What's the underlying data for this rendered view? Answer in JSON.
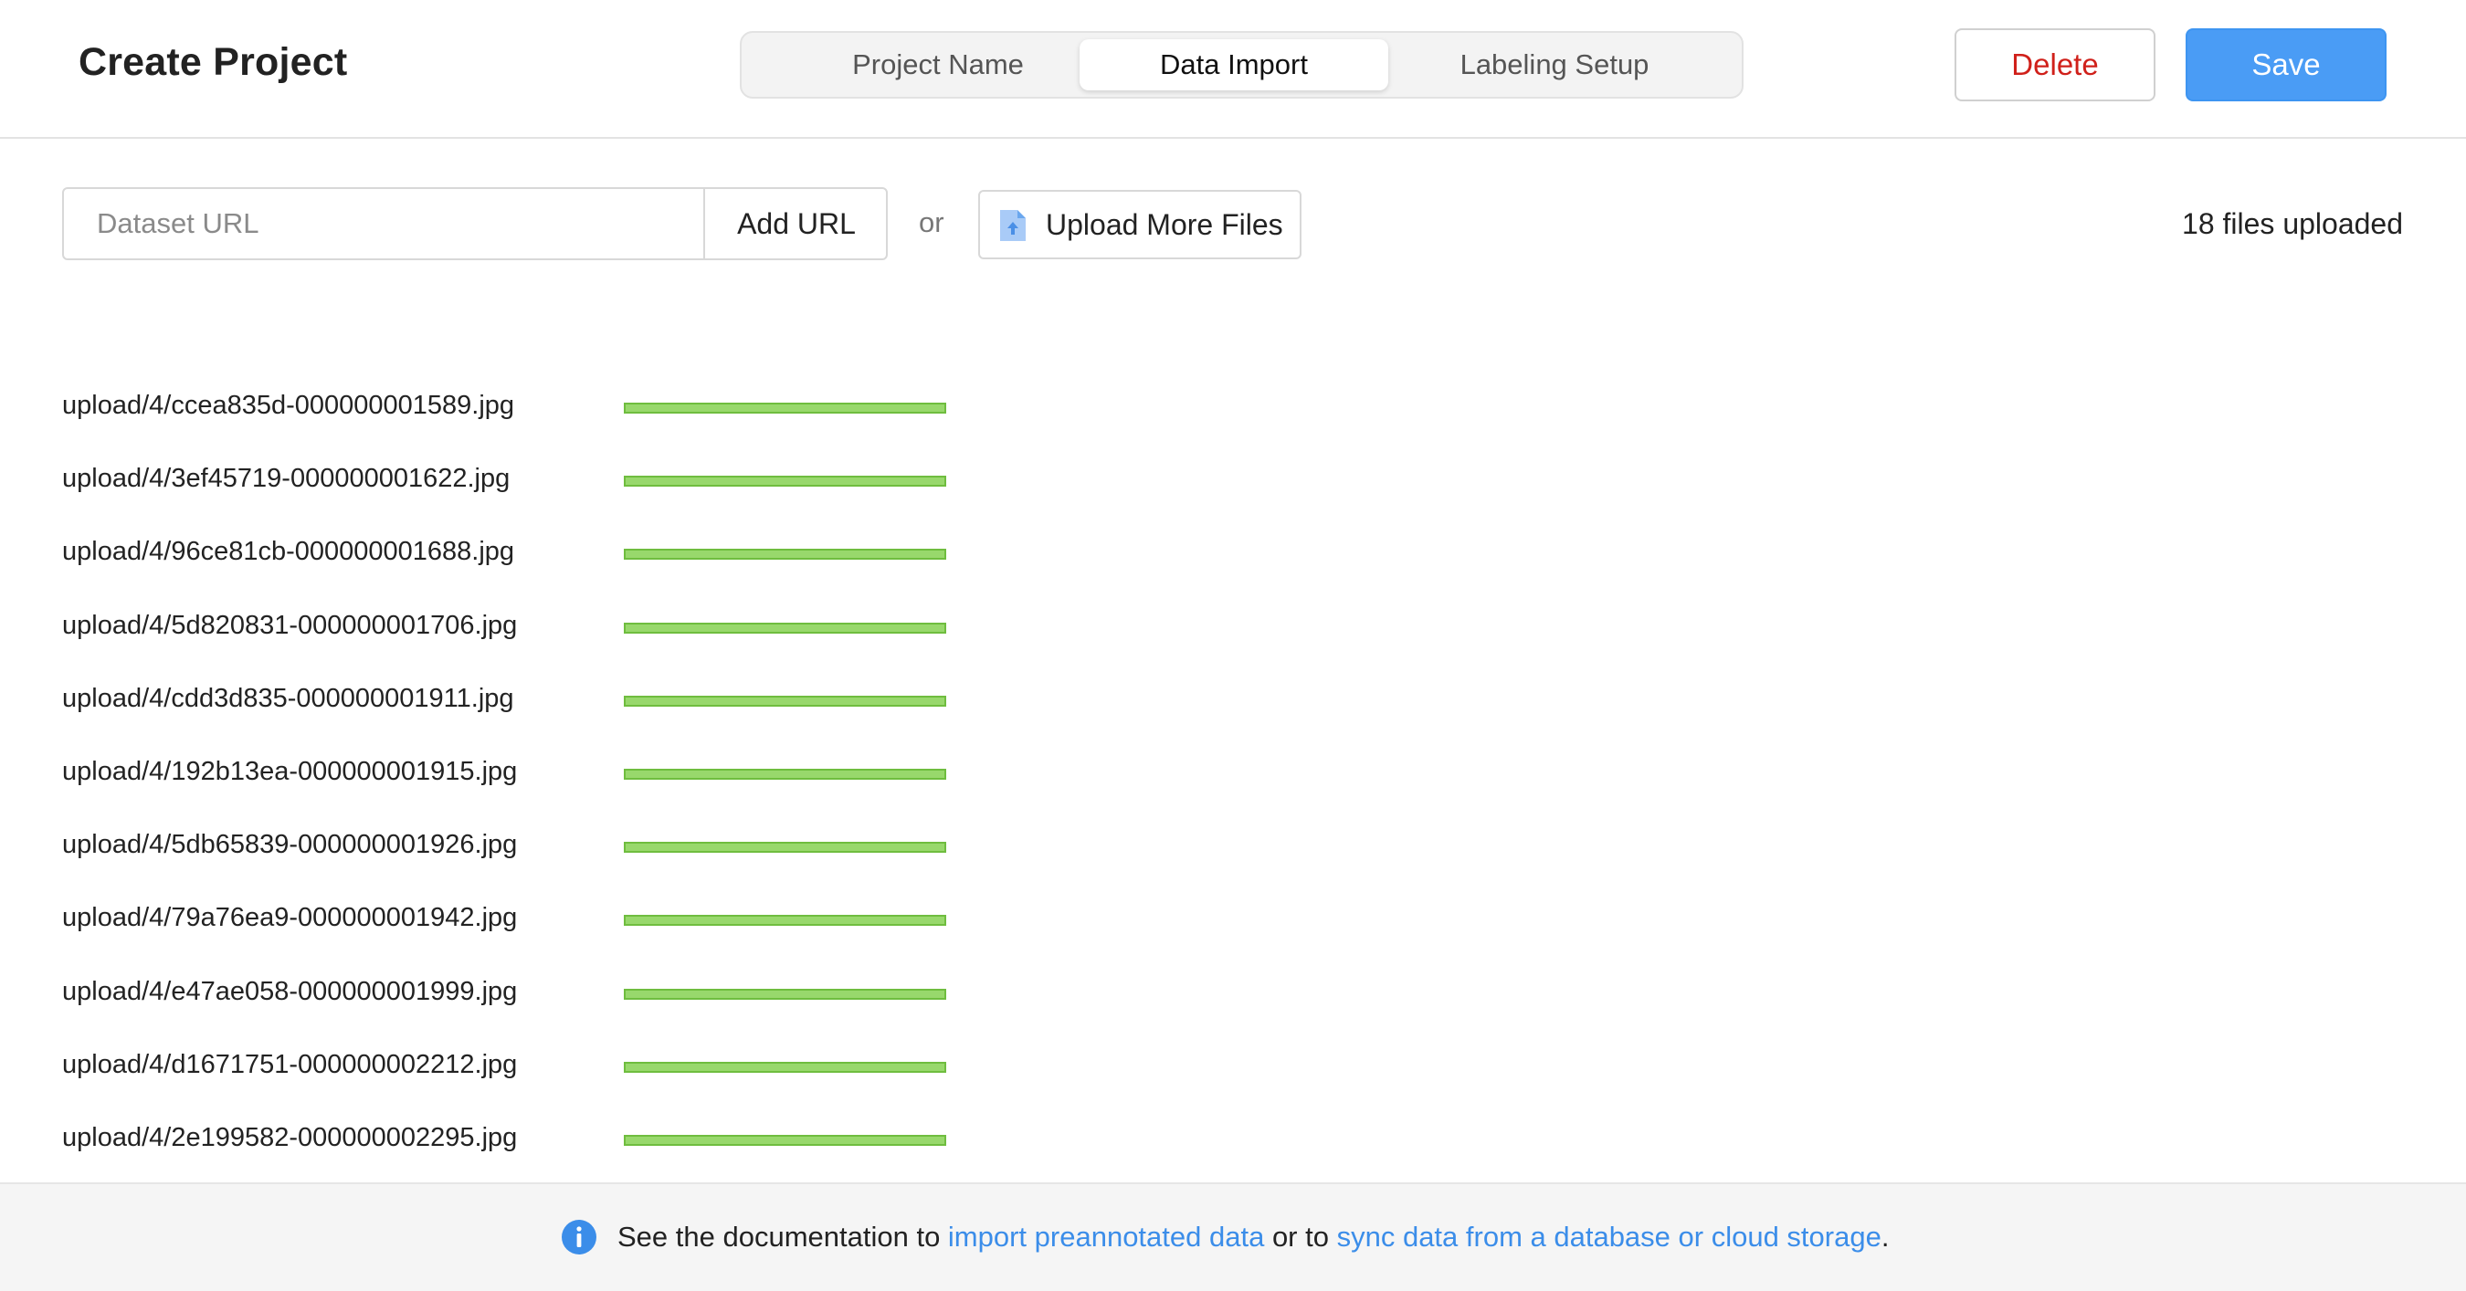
{
  "header": {
    "title": "Create Project",
    "steps": [
      {
        "label": "Project Name",
        "active": false
      },
      {
        "label": "Data Import",
        "active": true
      },
      {
        "label": "Labeling Setup",
        "active": false
      }
    ],
    "delete_label": "Delete",
    "save_label": "Save"
  },
  "import": {
    "url_placeholder": "Dataset URL",
    "url_value": "",
    "add_url_label": "Add URL",
    "or_label": "or",
    "upload_label": "Upload More Files",
    "files_count": "18 files uploaded"
  },
  "files": [
    {
      "name": "upload/4/ccea835d-000000001589.jpg",
      "progress": 1.0
    },
    {
      "name": "upload/4/3ef45719-000000001622.jpg",
      "progress": 1.0
    },
    {
      "name": "upload/4/96ce81cb-000000001688.jpg",
      "progress": 1.0
    },
    {
      "name": "upload/4/5d820831-000000001706.jpg",
      "progress": 1.0
    },
    {
      "name": "upload/4/cdd3d835-000000001911.jpg",
      "progress": 1.0
    },
    {
      "name": "upload/4/192b13ea-000000001915.jpg",
      "progress": 1.0
    },
    {
      "name": "upload/4/5db65839-000000001926.jpg",
      "progress": 1.0
    },
    {
      "name": "upload/4/79a76ea9-000000001942.jpg",
      "progress": 1.0
    },
    {
      "name": "upload/4/e47ae058-000000001999.jpg",
      "progress": 1.0
    },
    {
      "name": "upload/4/d1671751-000000002212.jpg",
      "progress": 1.0
    },
    {
      "name": "upload/4/2e199582-000000002295.jpg",
      "progress": 1.0
    }
  ],
  "footer": {
    "text_prefix": "See the documentation to ",
    "link1": "import preannotated data",
    "text_middle": " or to ",
    "link2": "sync data from a database or cloud storage",
    "text_suffix": "."
  },
  "colors": {
    "accent": "#4a9cf5",
    "danger": "#d0201a",
    "progress": "#98d86c",
    "link": "#3b8de9"
  },
  "icons": {
    "upload": "file-upload-icon",
    "info": "info-icon"
  }
}
